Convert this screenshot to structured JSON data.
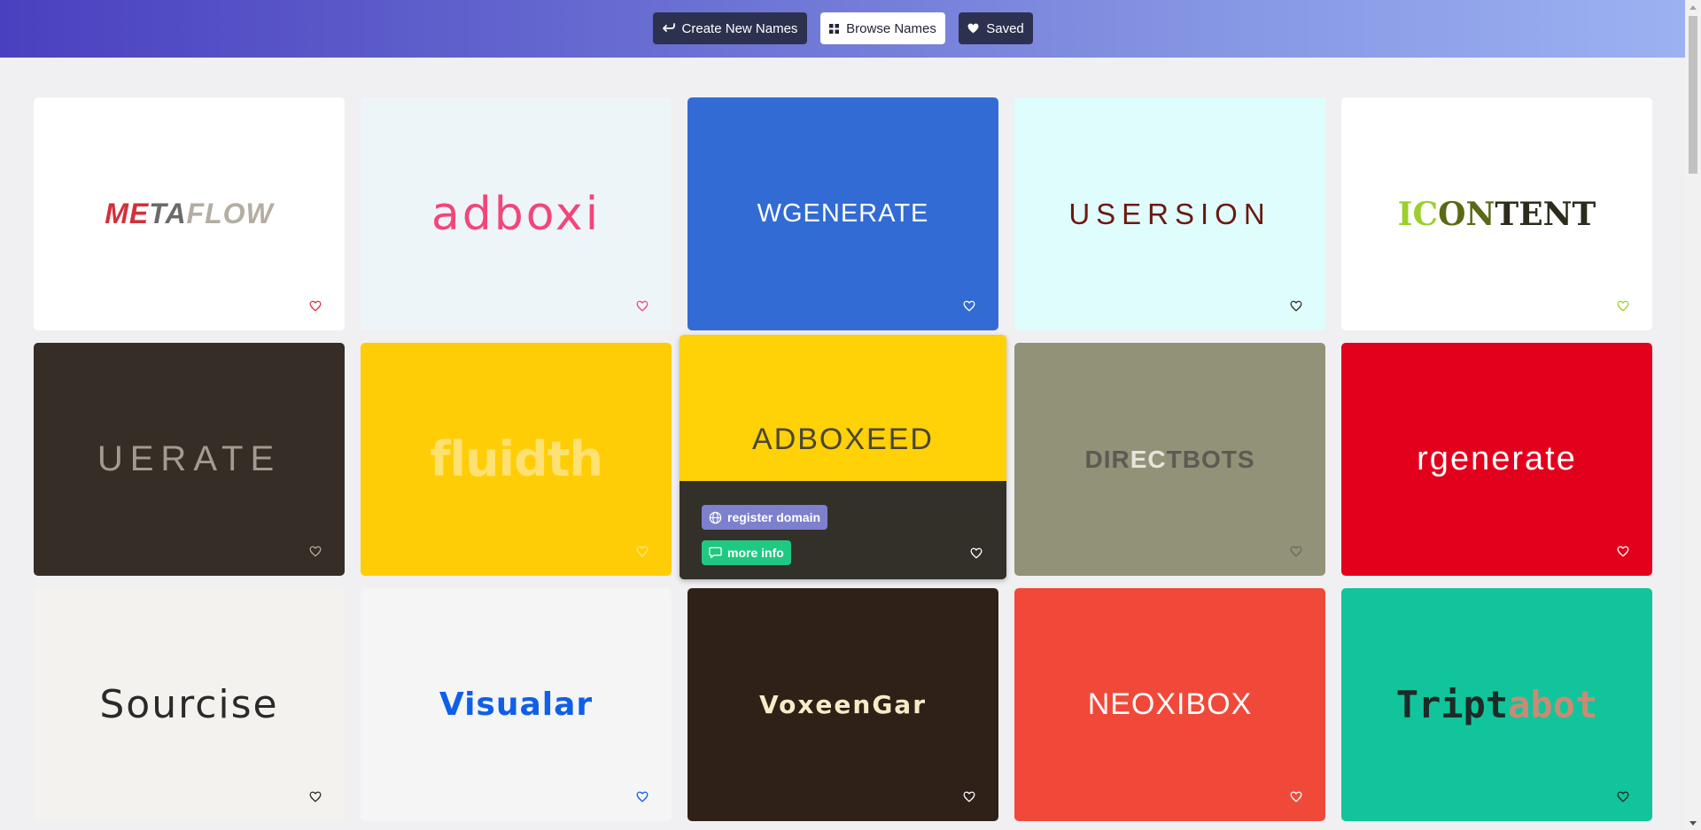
{
  "nav": {
    "create_label": "Create New Names",
    "browse_label": "Browse Names",
    "saved_label": "Saved",
    "create_icon": "arrow-return-icon",
    "browse_icon": "grid-icon",
    "saved_icon": "heart-icon"
  },
  "cards": [
    {
      "name": "METAFLOW",
      "bg": "#ffffff",
      "heart": "#e0323c"
    },
    {
      "name": "adboxi",
      "bg": "#eef5f9",
      "heart": "#f2467a"
    },
    {
      "name": "WGENERATE",
      "bg": "#326bd4",
      "heart": "#ffffff"
    },
    {
      "name": "USERSION",
      "bg": "#dffdfd",
      "heart": "#3a2a20"
    },
    {
      "name": "ICONTENT",
      "bg": "#ffffff",
      "heart": "#9ccf2b"
    },
    {
      "name": "UERATE",
      "bg": "#352d26",
      "heart": "#b2aaa0"
    },
    {
      "name": "fluidth",
      "bg": "#ffcd05",
      "heart": "#ffe48a"
    },
    {
      "name": "ADBOXEED",
      "bg": "#ffd107",
      "heart": "#ffffff"
    },
    {
      "name": "DIRECTBOTS",
      "bg": "#929278",
      "heart": "#6b6b58"
    },
    {
      "name": "rgenerate",
      "bg": "#e3001c",
      "heart": "#ffffff"
    },
    {
      "name": "Sourcise",
      "bg": "#f3f2ee",
      "heart": "#2a2a2a"
    },
    {
      "name": "Visualar",
      "bg": "#f5f5f6",
      "heart": "#0f5fe8"
    },
    {
      "name": "VoxeenGar",
      "bg": "#2f2118",
      "heart": "#ffffff"
    },
    {
      "name": "NEOXIBOX",
      "bg": "#f0493a",
      "heart": "#ffffff"
    },
    {
      "name": "Triptabot",
      "bg": "#11c49b",
      "heart": "#1d2a26"
    }
  ],
  "logo_parts": {
    "metaflow": [
      "ME",
      "TA",
      "FLOW"
    ],
    "icontent": [
      "IC",
      "ON",
      "TENT"
    ],
    "directbots": [
      "DIR",
      "EC",
      "TBOTS"
    ],
    "triptabot": [
      "Tript",
      "abot"
    ]
  },
  "hover": {
    "register_label": "register domain",
    "info_label": "more info",
    "register_icon": "globe-icon",
    "info_icon": "chat-icon"
  },
  "icons": {
    "card_heart": "heart-outline-icon",
    "scroll_up": "arrow-up-icon",
    "scroll_down": "arrow-down-icon"
  }
}
